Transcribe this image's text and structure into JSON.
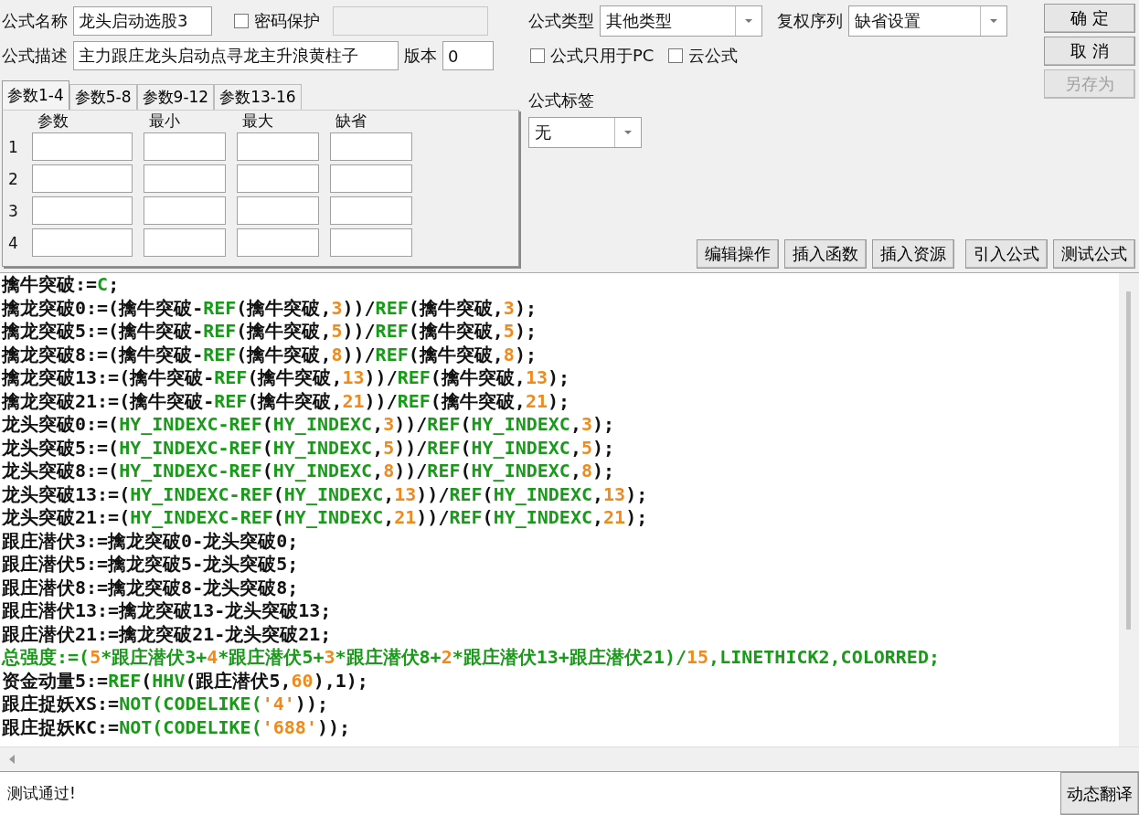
{
  "name_field": {
    "label": "公式名称",
    "value": "龙头启动选股3"
  },
  "password": {
    "label": "密码保护",
    "checked": false
  },
  "description_field": {
    "label": "公式描述",
    "value": "主力跟庄龙头启动点寻龙主升浪黄柱子"
  },
  "version_field": {
    "label": "版本",
    "value": "0"
  },
  "formula_type": {
    "label": "公式类型",
    "value": "其他类型"
  },
  "adjust_sequence": {
    "label": "复权序列",
    "value": "缺省设置"
  },
  "options": [
    {
      "label": "公式只用于PC",
      "checked": false
    },
    {
      "label": "云公式",
      "checked": false
    }
  ],
  "formula_tag": {
    "label": "公式标签",
    "value": "无"
  },
  "side_buttons": [
    {
      "label": "确  定",
      "disabled": false
    },
    {
      "label": "取  消",
      "disabled": false
    },
    {
      "label": "另存为",
      "disabled": true
    }
  ],
  "tabs": [
    {
      "label": "参数1-4",
      "selected": true
    },
    {
      "label": "参数5-8",
      "selected": false
    },
    {
      "label": "参数9-12",
      "selected": false
    },
    {
      "label": "参数13-16",
      "selected": false
    }
  ],
  "params": {
    "columns": [
      "参数",
      "最小",
      "最大",
      "缺省"
    ],
    "rows": [
      "1",
      "2",
      "3",
      "4"
    ]
  },
  "tool_buttons": [
    "编辑操作",
    "插入函数",
    "插入资源",
    "引入公式",
    "测试公式"
  ],
  "code_lines": [
    [
      {
        "kind": "plain",
        "text": "擒牛突破:="
      },
      {
        "kind": "func",
        "text": "C"
      },
      {
        "kind": "plain",
        "text": ";"
      }
    ],
    [
      {
        "kind": "plain",
        "text": "擒龙突破0:=(擒牛突破-"
      },
      {
        "kind": "func",
        "text": "REF"
      },
      {
        "kind": "plain",
        "text": "(擒牛突破,"
      },
      {
        "kind": "num",
        "text": "3"
      },
      {
        "kind": "plain",
        "text": "))/"
      },
      {
        "kind": "func",
        "text": "REF"
      },
      {
        "kind": "plain",
        "text": "(擒牛突破,"
      },
      {
        "kind": "num",
        "text": "3"
      },
      {
        "kind": "plain",
        "text": ");"
      }
    ],
    [
      {
        "kind": "plain",
        "text": "擒龙突破5:=(擒牛突破-"
      },
      {
        "kind": "func",
        "text": "REF"
      },
      {
        "kind": "plain",
        "text": "(擒牛突破,"
      },
      {
        "kind": "num",
        "text": "5"
      },
      {
        "kind": "plain",
        "text": "))/"
      },
      {
        "kind": "func",
        "text": "REF"
      },
      {
        "kind": "plain",
        "text": "(擒牛突破,"
      },
      {
        "kind": "num",
        "text": "5"
      },
      {
        "kind": "plain",
        "text": ");"
      }
    ],
    [
      {
        "kind": "plain",
        "text": "擒龙突破8:=(擒牛突破-"
      },
      {
        "kind": "func",
        "text": "REF"
      },
      {
        "kind": "plain",
        "text": "(擒牛突破,"
      },
      {
        "kind": "num",
        "text": "8"
      },
      {
        "kind": "plain",
        "text": "))/"
      },
      {
        "kind": "func",
        "text": "REF"
      },
      {
        "kind": "plain",
        "text": "(擒牛突破,"
      },
      {
        "kind": "num",
        "text": "8"
      },
      {
        "kind": "plain",
        "text": ");"
      }
    ],
    [
      {
        "kind": "plain",
        "text": "擒龙突破13:=(擒牛突破-"
      },
      {
        "kind": "func",
        "text": "REF"
      },
      {
        "kind": "plain",
        "text": "(擒牛突破,"
      },
      {
        "kind": "num",
        "text": "13"
      },
      {
        "kind": "plain",
        "text": "))/"
      },
      {
        "kind": "func",
        "text": "REF"
      },
      {
        "kind": "plain",
        "text": "(擒牛突破,"
      },
      {
        "kind": "num",
        "text": "13"
      },
      {
        "kind": "plain",
        "text": ");"
      }
    ],
    [
      {
        "kind": "plain",
        "text": "擒龙突破21:=(擒牛突破-"
      },
      {
        "kind": "func",
        "text": "REF"
      },
      {
        "kind": "plain",
        "text": "(擒牛突破,"
      },
      {
        "kind": "num",
        "text": "21"
      },
      {
        "kind": "plain",
        "text": "))/"
      },
      {
        "kind": "func",
        "text": "REF"
      },
      {
        "kind": "plain",
        "text": "(擒牛突破,"
      },
      {
        "kind": "num",
        "text": "21"
      },
      {
        "kind": "plain",
        "text": ");"
      }
    ],
    [
      {
        "kind": "plain",
        "text": "龙头突破0:=("
      },
      {
        "kind": "func",
        "text": "HY_INDEXC-REF"
      },
      {
        "kind": "plain",
        "text": "("
      },
      {
        "kind": "func",
        "text": "HY_INDEXC"
      },
      {
        "kind": "plain",
        "text": ","
      },
      {
        "kind": "num",
        "text": "3"
      },
      {
        "kind": "plain",
        "text": "))/"
      },
      {
        "kind": "func",
        "text": "REF"
      },
      {
        "kind": "plain",
        "text": "("
      },
      {
        "kind": "func",
        "text": "HY_INDEXC"
      },
      {
        "kind": "plain",
        "text": ","
      },
      {
        "kind": "num",
        "text": "3"
      },
      {
        "kind": "plain",
        "text": ");"
      }
    ],
    [
      {
        "kind": "plain",
        "text": "龙头突破5:=("
      },
      {
        "kind": "func",
        "text": "HY_INDEXC-REF"
      },
      {
        "kind": "plain",
        "text": "("
      },
      {
        "kind": "func",
        "text": "HY_INDEXC"
      },
      {
        "kind": "plain",
        "text": ","
      },
      {
        "kind": "num",
        "text": "5"
      },
      {
        "kind": "plain",
        "text": "))/"
      },
      {
        "kind": "func",
        "text": "REF"
      },
      {
        "kind": "plain",
        "text": "("
      },
      {
        "kind": "func",
        "text": "HY_INDEXC"
      },
      {
        "kind": "plain",
        "text": ","
      },
      {
        "kind": "num",
        "text": "5"
      },
      {
        "kind": "plain",
        "text": ");"
      }
    ],
    [
      {
        "kind": "plain",
        "text": "龙头突破8:=("
      },
      {
        "kind": "func",
        "text": "HY_INDEXC-REF"
      },
      {
        "kind": "plain",
        "text": "("
      },
      {
        "kind": "func",
        "text": "HY_INDEXC"
      },
      {
        "kind": "plain",
        "text": ","
      },
      {
        "kind": "num",
        "text": "8"
      },
      {
        "kind": "plain",
        "text": "))/"
      },
      {
        "kind": "func",
        "text": "REF"
      },
      {
        "kind": "plain",
        "text": "("
      },
      {
        "kind": "func",
        "text": "HY_INDEXC"
      },
      {
        "kind": "plain",
        "text": ","
      },
      {
        "kind": "num",
        "text": "8"
      },
      {
        "kind": "plain",
        "text": ");"
      }
    ],
    [
      {
        "kind": "plain",
        "text": "龙头突破13:=("
      },
      {
        "kind": "func",
        "text": "HY_INDEXC-REF"
      },
      {
        "kind": "plain",
        "text": "("
      },
      {
        "kind": "func",
        "text": "HY_INDEXC"
      },
      {
        "kind": "plain",
        "text": ","
      },
      {
        "kind": "num",
        "text": "13"
      },
      {
        "kind": "plain",
        "text": "))/"
      },
      {
        "kind": "func",
        "text": "REF"
      },
      {
        "kind": "plain",
        "text": "("
      },
      {
        "kind": "func",
        "text": "HY_INDEXC"
      },
      {
        "kind": "plain",
        "text": ","
      },
      {
        "kind": "num",
        "text": "13"
      },
      {
        "kind": "plain",
        "text": ");"
      }
    ],
    [
      {
        "kind": "plain",
        "text": "龙头突破21:=("
      },
      {
        "kind": "func",
        "text": "HY_INDEXC-REF"
      },
      {
        "kind": "plain",
        "text": "("
      },
      {
        "kind": "func",
        "text": "HY_INDEXC"
      },
      {
        "kind": "plain",
        "text": ","
      },
      {
        "kind": "num",
        "text": "21"
      },
      {
        "kind": "plain",
        "text": "))/"
      },
      {
        "kind": "func",
        "text": "REF"
      },
      {
        "kind": "plain",
        "text": "("
      },
      {
        "kind": "func",
        "text": "HY_INDEXC"
      },
      {
        "kind": "plain",
        "text": ","
      },
      {
        "kind": "num",
        "text": "21"
      },
      {
        "kind": "plain",
        "text": ");"
      }
    ],
    [
      {
        "kind": "plain",
        "text": "跟庄潜伏3:=擒龙突破0-龙头突破0;"
      }
    ],
    [
      {
        "kind": "plain",
        "text": "跟庄潜伏5:=擒龙突破5-龙头突破5;"
      }
    ],
    [
      {
        "kind": "plain",
        "text": "跟庄潜伏8:=擒龙突破8-龙头突破8;"
      }
    ],
    [
      {
        "kind": "plain",
        "text": "跟庄潜伏13:=擒龙突破13-龙头突破13;"
      }
    ],
    [
      {
        "kind": "plain",
        "text": "跟庄潜伏21:=擒龙突破21-龙头突破21;"
      }
    ],
    [
      {
        "kind": "func",
        "text": "总强度:=("
      },
      {
        "kind": "num",
        "text": "5"
      },
      {
        "kind": "func",
        "text": "*跟庄潜伏3+"
      },
      {
        "kind": "num",
        "text": "4"
      },
      {
        "kind": "func",
        "text": "*跟庄潜伏5+"
      },
      {
        "kind": "num",
        "text": "3"
      },
      {
        "kind": "func",
        "text": "*跟庄潜伏8+"
      },
      {
        "kind": "num",
        "text": "2"
      },
      {
        "kind": "func",
        "text": "*跟庄潜伏13+跟庄潜伏21)/"
      },
      {
        "kind": "num",
        "text": "15"
      },
      {
        "kind": "func",
        "text": ",LINETHICK2,COLORRED;"
      }
    ],
    [
      {
        "kind": "plain",
        "text": "资金动量5:="
      },
      {
        "kind": "func",
        "text": "REF"
      },
      {
        "kind": "plain",
        "text": "("
      },
      {
        "kind": "func",
        "text": "HHV"
      },
      {
        "kind": "plain",
        "text": "(跟庄潜伏5,"
      },
      {
        "kind": "num",
        "text": "60"
      },
      {
        "kind": "plain",
        "text": "),1);"
      }
    ],
    [
      {
        "kind": "plain",
        "text": "跟庄捉妖XS:="
      },
      {
        "kind": "func",
        "text": "NOT(CODELIKE("
      },
      {
        "kind": "num",
        "text": "'4'"
      },
      {
        "kind": "plain",
        "text": "));"
      }
    ],
    [
      {
        "kind": "plain",
        "text": "跟庄捉妖KC:="
      },
      {
        "kind": "func",
        "text": "NOT(CODELIKE("
      },
      {
        "kind": "num",
        "text": "'688'"
      },
      {
        "kind": "plain",
        "text": "));"
      }
    ]
  ],
  "status": {
    "message": "测试通过!",
    "button": "动态翻译"
  }
}
